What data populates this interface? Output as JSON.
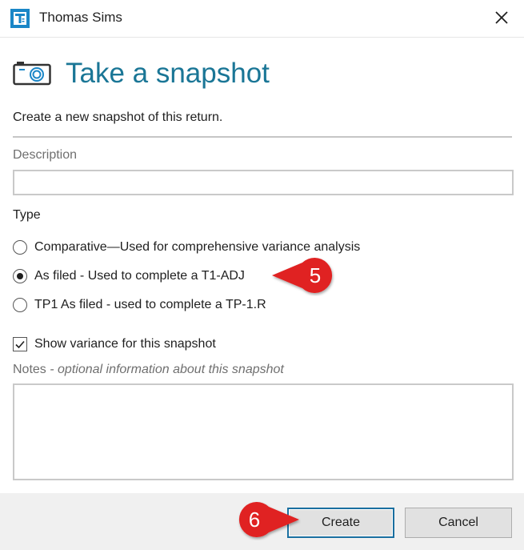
{
  "window": {
    "title": "Thomas Sims"
  },
  "header": {
    "title": "Take a snapshot",
    "subtitle": "Create a new snapshot of this return."
  },
  "description": {
    "label": "Description",
    "value": ""
  },
  "type": {
    "label": "Type",
    "options": [
      {
        "label": "Comparative—Used for comprehensive variance analysis",
        "selected": false
      },
      {
        "label": "As filed - Used to complete a T1-ADJ",
        "selected": true
      },
      {
        "label": "TP1 As filed - used to complete a TP-1.R",
        "selected": false
      }
    ]
  },
  "variance": {
    "label": "Show variance for this snapshot",
    "checked": true
  },
  "notes": {
    "label": "Notes",
    "hint": " - optional information about this snapshot",
    "value": ""
  },
  "buttons": {
    "create": "Create",
    "cancel": "Cancel"
  },
  "callouts": {
    "step_type": "5",
    "step_create": "6"
  },
  "colors": {
    "accent": "#1a7696",
    "callout_red": "#e02020",
    "primary_border": "#1a6fa0"
  }
}
